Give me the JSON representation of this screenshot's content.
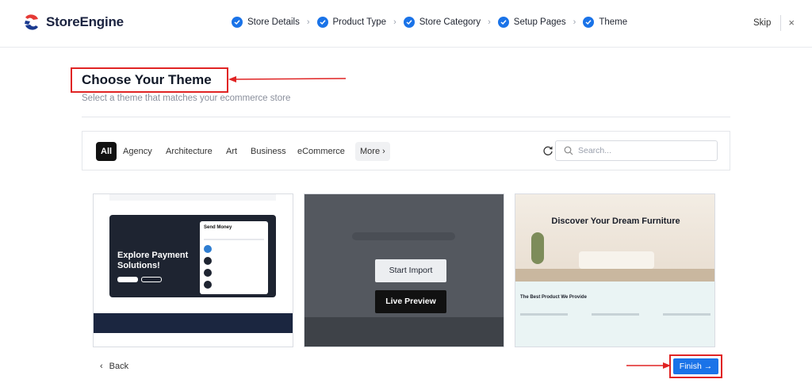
{
  "brand": {
    "name": "StoreEngine"
  },
  "steps": [
    {
      "label": "Store Details"
    },
    {
      "label": "Product Type"
    },
    {
      "label": "Store Category"
    },
    {
      "label": "Setup Pages"
    },
    {
      "label": "Theme"
    }
  ],
  "header": {
    "skip_label": "Skip",
    "close_glyph": "×"
  },
  "page": {
    "title": "Choose Your Theme",
    "subtitle": "Select a theme that matches your ecommerce store"
  },
  "filters": {
    "categories": [
      "All",
      "Agency",
      "Architecture",
      "Art",
      "Business",
      "eCommerce"
    ],
    "more_label": "More",
    "search_placeholder": "Search..."
  },
  "themes": {
    "card1": {
      "hero_title": "Explore Payment Solutions!",
      "panel_title": "Send Money"
    },
    "card2": {
      "start_import_label": "Start Import",
      "live_preview_label": "Live Preview"
    },
    "card3": {
      "hero_title": "Discover Your Dream Furniture",
      "section_title": "The Best Product We Provide"
    }
  },
  "footer": {
    "back_label": "Back",
    "finish_label": "Finish →"
  },
  "colors": {
    "accent": "#1a73e8",
    "annotation": "#e02424"
  }
}
